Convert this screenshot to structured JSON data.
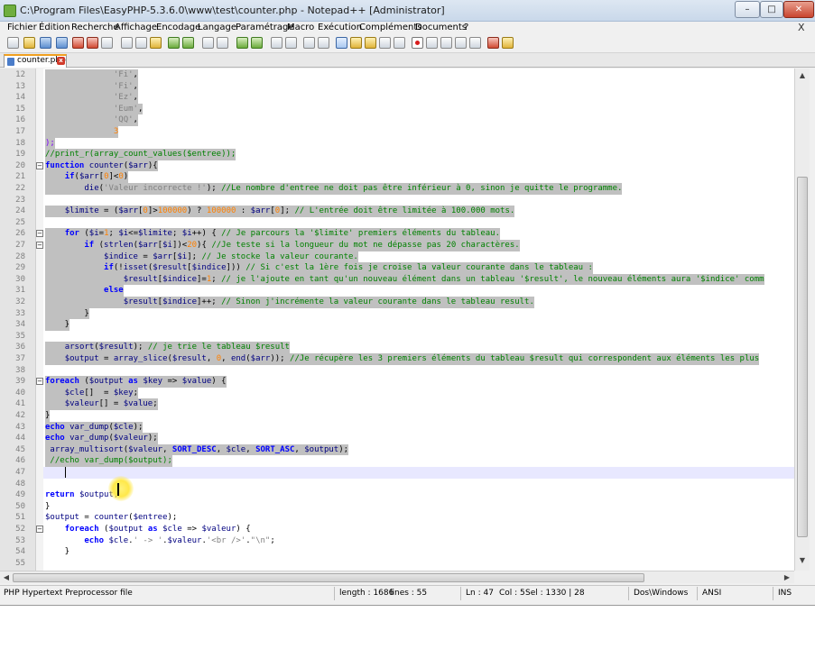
{
  "window": {
    "title": "C:\\Program Files\\EasyPHP-5.3.6.0\\www\\test\\counter.php - Notepad++ [Administrator]",
    "minimize": "–",
    "maximize": "□",
    "close": "✕"
  },
  "menu": {
    "items": [
      "Fichier",
      "Édition",
      "Recherche",
      "Affichage",
      "Encodage",
      "Langage",
      "Paramétrage",
      "Macro",
      "Exécution",
      "Compléments",
      "Documents",
      "?"
    ],
    "close_doc": "X"
  },
  "tab": {
    "label": "counter.php",
    "close": "x"
  },
  "editor": {
    "lines": [
      {
        "n": "12",
        "fold": "",
        "sel": true,
        "html": "              <span class='str'>'Fi'</span>,"
      },
      {
        "n": "13",
        "fold": "",
        "sel": true,
        "html": "              <span class='str'>'Fi'</span>,"
      },
      {
        "n": "14",
        "fold": "",
        "sel": true,
        "html": "              <span class='str'>'Ez'</span>,"
      },
      {
        "n": "15",
        "fold": "",
        "sel": true,
        "html": "              <span class='str'>'Eum'</span>,"
      },
      {
        "n": "16",
        "fold": "",
        "sel": true,
        "html": "              <span class='str'>'QQ'</span>,"
      },
      {
        "n": "17",
        "fold": "",
        "sel": true,
        "html": "              <span class='num'>3</span>"
      },
      {
        "n": "18",
        "fold": "",
        "sel": true,
        "html": "<span class='op'>);</span>"
      },
      {
        "n": "19",
        "fold": "",
        "sel": true,
        "html": "<span class='cm'>//print_r(array_count_values($entree));</span>"
      },
      {
        "n": "20",
        "fold": "−",
        "sel": true,
        "html": "<span class='kw'>function</span> <span class='fn'>counter</span>(<span class='var'>$arr</span>){"
      },
      {
        "n": "21",
        "fold": "",
        "sel": true,
        "html": "    <span class='kw'>if</span>(<span class='var'>$arr</span>[<span class='num'>0</span>]&lt;<span class='num'>0</span>)"
      },
      {
        "n": "22",
        "fold": "",
        "sel": true,
        "html": "        <span class='fn'>die</span>(<span class='str'>'Valeur incorrecte !'</span>); <span class='cm'>//Le nombre d'entree ne doit pas être inférieur à 0, sinon je quitte le programme.</span>"
      },
      {
        "n": "23",
        "fold": "",
        "sel": true,
        "html": ""
      },
      {
        "n": "24",
        "fold": "",
        "sel": true,
        "html": "    <span class='var'>$limite</span> = (<span class='var'>$arr</span>[<span class='num'>0</span>]&gt;<span class='num'>100000</span>) ? <span class='num'>100000</span> : <span class='var'>$arr</span>[<span class='num'>0</span>]; <span class='cm'>// L'entrée doit être limitée à 100.000 mots.</span>"
      },
      {
        "n": "25",
        "fold": "",
        "sel": true,
        "html": ""
      },
      {
        "n": "26",
        "fold": "−",
        "sel": true,
        "html": "    <span class='kw'>for</span> (<span class='var'>$i</span>=<span class='num'>1</span>; <span class='var'>$i</span>&lt;=<span class='var'>$limite</span>; <span class='var'>$i</span>++) { <span class='cm'>// Je parcours la '$limite' premiers éléments du tableau.</span>"
      },
      {
        "n": "27",
        "fold": "−",
        "sel": true,
        "html": "        <span class='kw'>if</span> (<span class='fn'>strlen</span>(<span class='var'>$arr</span>[<span class='var'>$i</span>])&lt;<span class='num'>20</span>){ <span class='cm'>//Je teste si la longueur du mot ne dépasse pas 20 charactères.</span>"
      },
      {
        "n": "28",
        "fold": "",
        "sel": true,
        "html": "            <span class='var'>$indice</span> = <span class='var'>$arr</span>[<span class='var'>$i</span>]; <span class='cm'>// Je stocke la valeur courante.</span>"
      },
      {
        "n": "29",
        "fold": "",
        "sel": true,
        "html": "            <span class='kw'>if</span>(!<span class='fn'>isset</span>(<span class='var'>$result</span>[<span class='var'>$indice</span>])) <span class='cm'>// Si c'est la 1ère fois je croise la valeur courante dans le tableau :</span>"
      },
      {
        "n": "30",
        "fold": "",
        "sel": true,
        "html": "                <span class='var'>$result</span>[<span class='var'>$indice</span>]=<span class='num'>1</span>; <span class='cm'>// je l'ajoute en tant qu'un nouveau élément dans un tableau '$result', le nouveau éléments aura '$indice' comm</span>"
      },
      {
        "n": "31",
        "fold": "",
        "sel": true,
        "html": "            <span class='kw'>else</span>"
      },
      {
        "n": "32",
        "fold": "",
        "sel": true,
        "html": "                <span class='var'>$result</span>[<span class='var'>$indice</span>]++; <span class='cm'>// Sinon j'incrémente la valeur courante dans le tableau result.</span>"
      },
      {
        "n": "33",
        "fold": "",
        "sel": true,
        "html": "        }"
      },
      {
        "n": "34",
        "fold": "",
        "sel": true,
        "html": "    }"
      },
      {
        "n": "35",
        "fold": "",
        "sel": true,
        "html": ""
      },
      {
        "n": "36",
        "fold": "",
        "sel": true,
        "html": "    <span class='fn'>arsort</span>(<span class='var'>$result</span>); <span class='cm'>// je trie le tableau $result</span>"
      },
      {
        "n": "37",
        "fold": "",
        "sel": true,
        "html": "    <span class='var'>$output</span> = <span class='fn'>array_slice</span>(<span class='var'>$result</span>, <span class='num'>0</span>, <span class='fn'>end</span>(<span class='var'>$arr</span>)); <span class='cm'>//Je récupère les 3 premiers éléments du tableau $result qui correspondent aux éléments les plus</span>"
      },
      {
        "n": "38",
        "fold": "",
        "sel": true,
        "html": ""
      },
      {
        "n": "39",
        "fold": "−",
        "sel": true,
        "html": "<span class='kw'>foreach</span> (<span class='var'>$output</span> <span class='kw'>as</span> <span class='var'>$key</span> =&gt; <span class='var'>$value</span>) {"
      },
      {
        "n": "40",
        "fold": "",
        "sel": true,
        "html": "    <span class='var'>$cle</span>[]  = <span class='var'>$key</span>;"
      },
      {
        "n": "41",
        "fold": "",
        "sel": true,
        "html": "    <span class='var'>$valeur</span>[] = <span class='var'>$value</span>;"
      },
      {
        "n": "42",
        "fold": "",
        "sel": true,
        "html": "}"
      },
      {
        "n": "43",
        "fold": "",
        "sel": true,
        "html": "<span class='kw'>echo</span> <span class='fn'>var_dump</span>(<span class='var'>$cle</span>);"
      },
      {
        "n": "44",
        "fold": "",
        "sel": true,
        "html": "<span class='kw'>echo</span> <span class='fn'>var_dump</span>(<span class='var'>$valeur</span>);"
      },
      {
        "n": "45",
        "fold": "",
        "sel": true,
        "html": " <span class='fn'>array_multisort</span>(<span class='var'>$valeur</span>, <span class='kw'>SORT_DESC</span>, <span class='var'>$cle</span>, <span class='kw'>SORT_ASC</span>, <span class='var'>$output</span>);"
      },
      {
        "n": "46",
        "fold": "",
        "sel": true,
        "html": " <span class='cm'>//echo var_dump($output);</span>"
      },
      {
        "n": "47",
        "fold": "",
        "sel": false,
        "html": ""
      },
      {
        "n": "48",
        "fold": "",
        "sel": false,
        "html": ""
      },
      {
        "n": "49",
        "fold": "",
        "sel": false,
        "html": "<span class='kw'>return</span> <span class='var'>$output</span>;"
      },
      {
        "n": "50",
        "fold": "",
        "sel": false,
        "html": "}"
      },
      {
        "n": "51",
        "fold": "",
        "sel": false,
        "html": "<span class='var'>$output</span> = <span class='fn'>counter</span>(<span class='var'>$entree</span>);"
      },
      {
        "n": "52",
        "fold": "−",
        "sel": false,
        "html": "    <span class='kw'>foreach</span> (<span class='var'>$output</span> <span class='kw'>as</span> <span class='var'>$cle</span> =&gt; <span class='var'>$valeur</span>) {"
      },
      {
        "n": "53",
        "fold": "",
        "sel": false,
        "html": "        <span class='kw'>echo</span> <span class='var'>$cle</span>.<span class='str'>' -&gt; '</span>.<span class='var'>$valeur</span>.<span class='str'>'&lt;br /&gt;'</span>.<span class='str'>\"\\n\"</span>;"
      },
      {
        "n": "54",
        "fold": "",
        "sel": false,
        "html": "    }"
      },
      {
        "n": "55",
        "fold": "",
        "sel": false,
        "html": ""
      }
    ]
  },
  "status": {
    "filetype": "PHP Hypertext Preprocessor file",
    "length": "length : 1686",
    "lines": "lines : 55",
    "ln": "Ln : 47",
    "col": "Col : 5",
    "sel": "Sel : 1330 | 28",
    "eol": "Dos\\Windows",
    "encoding": "ANSI",
    "mode": "INS"
  }
}
